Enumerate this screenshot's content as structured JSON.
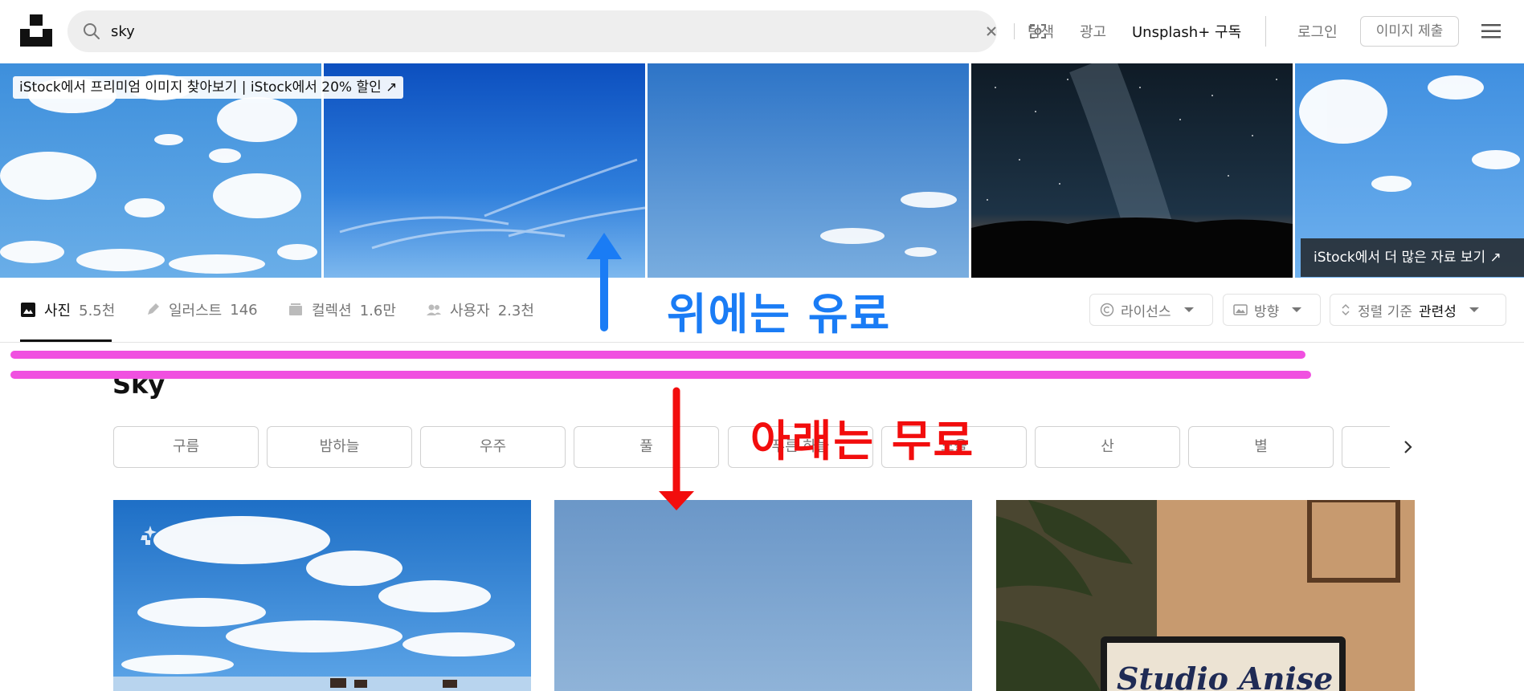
{
  "header": {
    "search_value": "sky",
    "nav": {
      "explore": "탐색",
      "ads": "광고",
      "plus": "Unsplash+ 구독",
      "login": "로그인",
      "submit": "이미지 제출"
    }
  },
  "banner": {
    "tag": "iStock에서 프리미엄 이미지 찾아보기 | iStock에서 20% 할인 ↗",
    "more": "iStock에서 더 많은 자료 보기 ↗"
  },
  "tabs": [
    {
      "label": "사진",
      "count": "5.5천",
      "icon": "image-icon"
    },
    {
      "label": "일러스트",
      "count": "146",
      "icon": "pen-icon"
    },
    {
      "label": "컬렉션",
      "count": "1.6만",
      "icon": "collection-icon"
    },
    {
      "label": "사용자",
      "count": "2.3천",
      "icon": "users-icon"
    }
  ],
  "dropdowns": {
    "license": "라이선스",
    "orientation": "방향",
    "sort_label": "정렬 기준",
    "sort_value": "관련성"
  },
  "page_title": "Sky",
  "chips": [
    "구름",
    "밤하늘",
    "우주",
    "풀",
    "푸른 하늘",
    "노을",
    "산",
    "별"
  ],
  "annotations": {
    "top": "위에는 유료",
    "bottom": "아래는 무료"
  },
  "colors": {
    "annotation_blue": "#1a7cf5",
    "annotation_red": "#f20d0d",
    "annotation_magenta": "#f050e0"
  }
}
